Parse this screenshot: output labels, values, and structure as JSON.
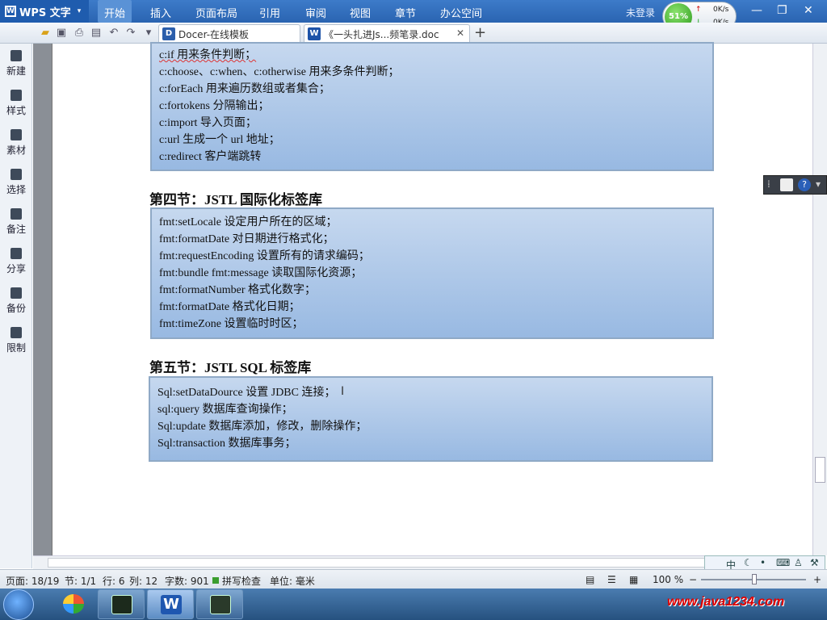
{
  "app": {
    "name": "WPS 文字",
    "logo_letter": "W"
  },
  "menu": [
    "开始",
    "插入",
    "页面布局",
    "引用",
    "审阅",
    "视图",
    "章节",
    "办公空间"
  ],
  "account": {
    "login": "未登录"
  },
  "network": {
    "percent": "51%",
    "up": "0K/s",
    "down": "0K/s"
  },
  "tabs": [
    {
      "label": "Docer-在线模板",
      "icon": "D"
    },
    {
      "label": "《一头扎进Js...频笔录.doc",
      "icon": "W"
    }
  ],
  "sidebar": [
    "新建",
    "样式",
    "素材",
    "选择",
    "备注",
    "分享",
    "备份",
    "限制"
  ],
  "document": {
    "box1": [
      "c:if 用来条件判断；",
      "c:choose、c:when、c:otherwise 用来多条件判断；",
      "c:forEach 用来遍历数组或者集合；",
      "c:fortokens 分隔输出；",
      "c:import 导入页面；",
      "c:url 生成一个 url 地址；",
      "c:redirect 客户端跳转"
    ],
    "heading4": "第四节：JSTL 国际化标签库",
    "box2": [
      "fmt:setLocale 设定用户所在的区域；",
      "fmt:formatDate 对日期进行格式化；",
      "fmt:requestEncoding 设置所有的请求编码；",
      "fmt:bundle fmt:message 读取国际化资源；",
      "fmt:formatNumber 格式化数字；",
      "fmt:formatDate 格式化日期；",
      "fmt:timeZone 设置临时时区；"
    ],
    "heading5": "第五节：JSTL SQL 标签库",
    "box3": [
      "Sql:setDataDource 设置 JDBC 连接；",
      "sql:query 数据库查询操作；",
      "Sql:update 数据库添加，修改，删除操作；",
      "Sql:transaction 数据库事务；"
    ]
  },
  "ime": {
    "label": "中"
  },
  "status": {
    "page": "页面: 18/19",
    "section": "节: 1/1",
    "row": "行: 6",
    "col": "列: 12",
    "words": "字数: 901",
    "spell": "拼写检查",
    "unit": "单位: 毫米",
    "zoom": "100 %"
  },
  "watermark": "www.java1234.com",
  "colors": {
    "accent": "#2a64b1",
    "box": "#a9c4e8"
  }
}
